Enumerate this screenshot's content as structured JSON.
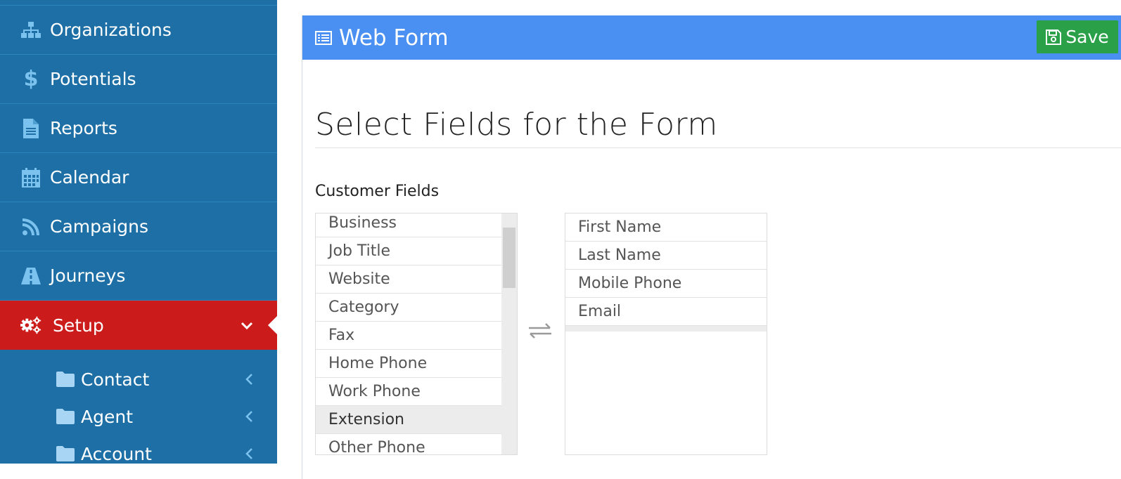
{
  "sidebar": {
    "items": [
      {
        "label": "Organizations",
        "icon": "sitemap-icon"
      },
      {
        "label": "Potentials",
        "icon": "dollar-icon"
      },
      {
        "label": "Reports",
        "icon": "file-text-icon"
      },
      {
        "label": "Calendar",
        "icon": "calendar-icon"
      },
      {
        "label": "Campaigns",
        "icon": "rss-icon"
      },
      {
        "label": "Journeys",
        "icon": "road-icon"
      },
      {
        "label": "Setup",
        "icon": "gears-icon",
        "active": true
      }
    ],
    "subitems": [
      {
        "label": "Contact",
        "icon": "folder-icon"
      },
      {
        "label": "Agent",
        "icon": "folder-icon"
      },
      {
        "label": "Account",
        "icon": "folder-icon"
      }
    ],
    "colors": {
      "background": "#1d6fa5",
      "active": "#cc1b1b"
    }
  },
  "panel": {
    "title": "Web Form",
    "save_label": "Save",
    "header_color": "#4a8ff2",
    "save_color": "#2aa149"
  },
  "form": {
    "section_title": "Select Fields for the Form",
    "group_label": "Customer Fields",
    "available_fields": [
      "Business",
      "Job Title",
      "Website",
      "Category",
      "Fax",
      "Home Phone",
      "Work Phone",
      "Extension",
      "Other Phone"
    ],
    "highlighted_field": "Extension",
    "selected_fields": [
      "First Name",
      "Last Name",
      "Mobile Phone",
      "Email"
    ]
  }
}
